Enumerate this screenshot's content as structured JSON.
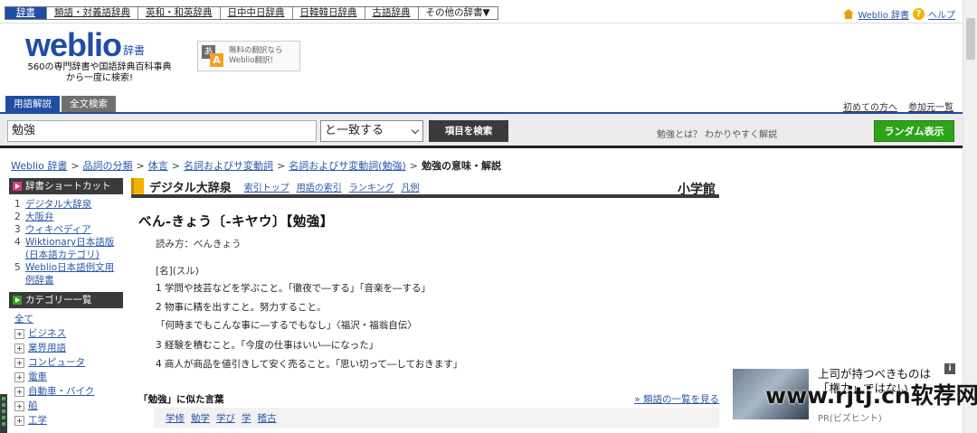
{
  "topnav": {
    "items": [
      "辞書",
      "類語・対義語辞典",
      "英和・和英辞典",
      "日中中日辞典",
      "日韓韓日辞典",
      "古語辞典",
      "その他の辞書▼"
    ],
    "home_label": "Weblio 辞書",
    "help_label": "ヘルプ"
  },
  "header": {
    "logo_text": "weblio",
    "logo_suffix": "辞書",
    "tagline_line1": "560の専門辞書や国語辞典百科事典",
    "tagline_line2": "から一度に検索!",
    "translate_line1": "無料の翻訳なら",
    "translate_line2": "Weblio翻訳!"
  },
  "tabs": [
    "用語解説",
    "全文検索"
  ],
  "helplinks": [
    "初めての方へ",
    "参加元一覧"
  ],
  "search": {
    "value": "勉強",
    "match_mode": "と一致する",
    "button_label": "項目を検索",
    "whatis_text": "勉強とは？ わかりやすく解説",
    "random_label": "ランダム表示"
  },
  "breadcrumb": [
    "Weblio 辞書",
    "品詞の分類",
    "体言",
    "名詞およびサ変動詞",
    "名詞およびサ変動詞(勉強)",
    "勉強の意味・解説"
  ],
  "sidebar": {
    "shortcut_title": "辞書ショートカット",
    "shortcuts": [
      {
        "num": "1",
        "label": "デジタル大辞泉"
      },
      {
        "num": "2",
        "label": "大阪弁"
      },
      {
        "num": "3",
        "label": "ウィキペディア"
      },
      {
        "num": "4",
        "label": "Wiktionary日本語版(日本語カテゴリ)"
      },
      {
        "num": "5",
        "label": "Weblio日本語例文用例辞書"
      }
    ],
    "category_title": "カテゴリー一覧",
    "all_label": "全て",
    "categories": [
      "ビジネス",
      "業界用語",
      "コンピュータ",
      "電車",
      "自動車・バイク",
      "船",
      "工学"
    ]
  },
  "dictionary": {
    "name": "デジタル大辞泉",
    "links": [
      "索引トップ",
      "用語の索引",
      "ランキング",
      "凡例"
    ],
    "publisher": "小学館"
  },
  "entry": {
    "title": "べん‐きょう〔‐キヤウ〕【勉強】",
    "reading": "読み方：べんきょう",
    "pos": "[名](スル)",
    "definitions": [
      "1 学問や技芸などを学ぶこと。「徹夜で―する」「音楽を―する」",
      "2 物事に精を出すこと。努力すること。",
      "「何時までもこんな事に―するでもなし」〈福沢・福翁自伝〉",
      "3 経験を積むこと。「今度の仕事はいい―になった」",
      "4 商人が商品を値引きして安く売ること。「思い切って―しておきます」"
    ]
  },
  "similar": {
    "heading": "「勉強」に似た言葉",
    "more_label": "» 類語の一覧を見る",
    "words": [
      "学修",
      "勉学",
      "学び",
      "学",
      "稽古"
    ]
  },
  "ad": {
    "title_line1": "上司が持つべきものは",
    "title_line2": "「権力」ではない",
    "pr": "PR(ビズヒント)",
    "info": "i"
  },
  "watermark": "www.rjtj.cn软荐网"
}
